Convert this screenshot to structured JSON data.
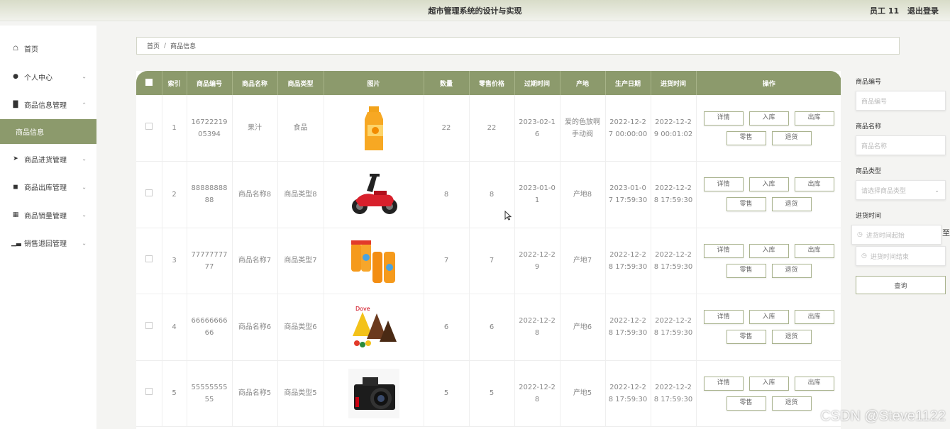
{
  "header": {
    "title": "超市管理系统的设计与实现",
    "user": "员工 11",
    "logout": "退出登录"
  },
  "sidebar": {
    "items": [
      {
        "label": "首页"
      },
      {
        "label": "个人中心"
      },
      {
        "label": "商品信息管理"
      },
      {
        "label": "商品进货管理"
      },
      {
        "label": "商品出库管理"
      },
      {
        "label": "商品销量管理"
      },
      {
        "label": "销售退回管理"
      }
    ],
    "active_sub": "商品信息"
  },
  "breadcrumb": {
    "home": "首页",
    "sep": "/",
    "current": "商品信息"
  },
  "table": {
    "headers": [
      "索引",
      "商品编号",
      "商品名称",
      "商品类型",
      "图片",
      "数量",
      "零售价格",
      "过期时间",
      "产地",
      "生产日期",
      "进货时间",
      "操作"
    ],
    "rows": [
      {
        "index": "1",
        "code": "1672221905394",
        "name": "果汁",
        "type": "食品",
        "qty": "22",
        "price": "22",
        "expire": "2023-02-16",
        "origin": "爱的色放啊手动阀",
        "produce": "2022-12-27 00:00:00",
        "stock_in": "2022-12-29 00:01:02"
      },
      {
        "index": "2",
        "code": "8888888888",
        "name": "商品名称8",
        "type": "商品类型8",
        "qty": "8",
        "price": "8",
        "expire": "2023-01-01",
        "origin": "产地8",
        "produce": "2023-01-07 17:59:30",
        "stock_in": "2022-12-28 17:59:30"
      },
      {
        "index": "3",
        "code": "7777777777",
        "name": "商品名称7",
        "type": "商品类型7",
        "qty": "7",
        "price": "7",
        "expire": "2022-12-29",
        "origin": "产地7",
        "produce": "2022-12-28 17:59:30",
        "stock_in": "2022-12-28 17:59:30"
      },
      {
        "index": "4",
        "code": "6666666666",
        "name": "商品名称6",
        "type": "商品类型6",
        "qty": "6",
        "price": "6",
        "expire": "2022-12-28",
        "origin": "产地6",
        "produce": "2022-12-28 17:59:30",
        "stock_in": "2022-12-28 17:59:30"
      },
      {
        "index": "5",
        "code": "5555555555",
        "name": "商品名称5",
        "type": "商品类型5",
        "qty": "5",
        "price": "5",
        "expire": "2022-12-28",
        "origin": "产地5",
        "produce": "2022-12-28 17:59:30",
        "stock_in": "2022-12-28 17:59:30"
      }
    ],
    "ops": {
      "detail": "详情",
      "stock_in": "入库",
      "stock_out": "出库",
      "retail": "零售",
      "return": "退货"
    }
  },
  "search": {
    "code_label": "商品编号",
    "code_placeholder": "商品编号",
    "name_label": "商品名称",
    "name_placeholder": "商品名称",
    "type_label": "商品类型",
    "type_placeholder": "请选择商品类型",
    "time_label": "进货时间",
    "time_start": "进货时间起始",
    "time_end": "进货时间结束",
    "range_sep": "至",
    "query": "查询"
  },
  "watermark": "CSDN @Steve1122",
  "colors": {
    "accent": "#8c9a6c"
  }
}
